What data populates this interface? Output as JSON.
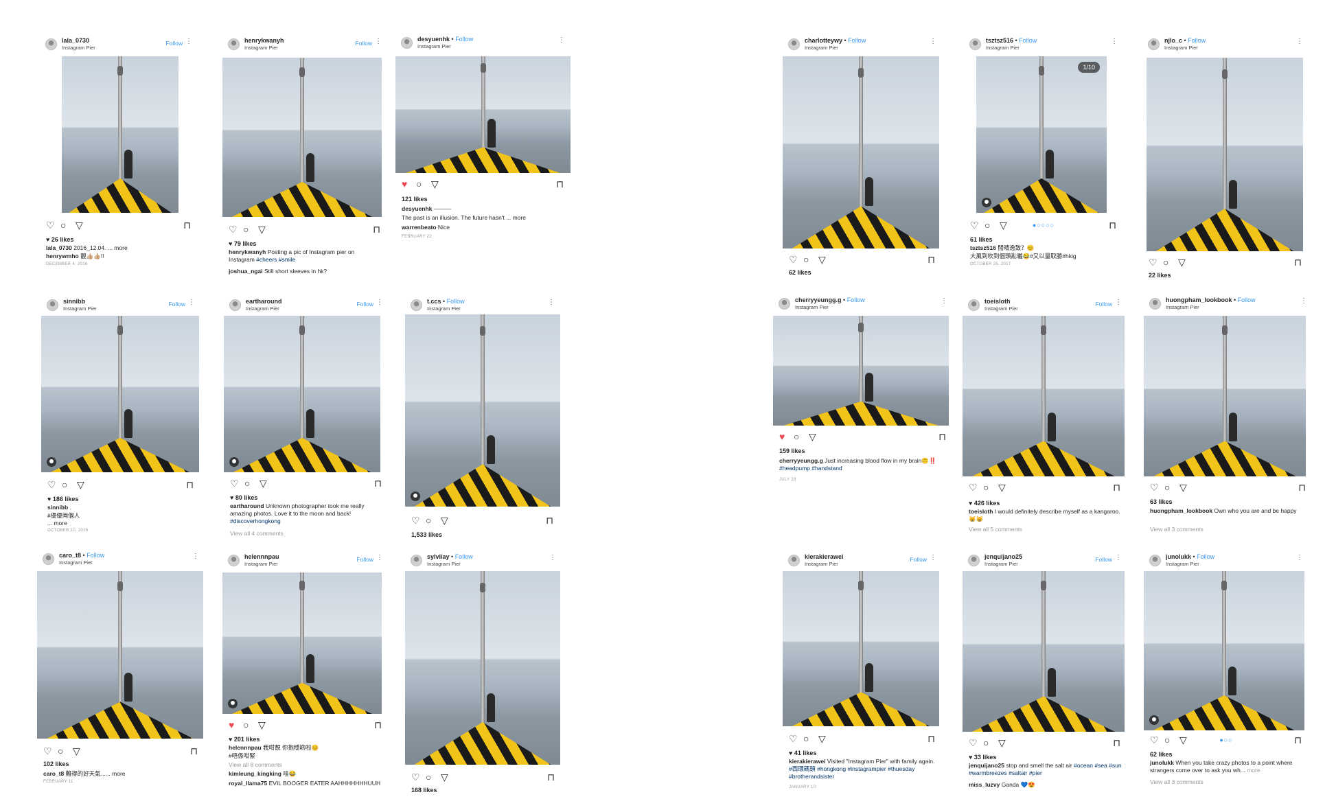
{
  "posts": [
    {
      "id": "p1",
      "user": "lala_0730",
      "location": "Instagram Pier",
      "follow": "Follow",
      "likes": "26 likes",
      "caption_user": "lala_0730",
      "caption": "2016_12.04.",
      "more": "... more",
      "comment_user": "henrywmho",
      "comment": "靚👍🏼👍🏼!!",
      "date": "DECEMBER 4, 2016"
    },
    {
      "id": "p2",
      "user": "henrykwanyh",
      "location": "Instagram Pier",
      "follow": "Follow",
      "likes": "79 likes",
      "caption_user": "henrykwanyh",
      "caption": "Posting a pic of Instagram pier on Instagram",
      "hashtags": "#cheers #smile",
      "comment_user": "joshua_ngai",
      "comment": "Still short sleeves in hk?"
    },
    {
      "id": "p3",
      "user": "desyuenhk",
      "dot": " • ",
      "follow": "Follow",
      "location": "Instagram Pier",
      "likes": "121 likes",
      "caption_user": "desyuenhk",
      "caption": "———",
      "line2": "The past is an illusion. The future hasn't",
      "more": "... more",
      "comment_user": "warrenbeato",
      "comment": "Nice",
      "date": "FEBRUARY 22"
    },
    {
      "id": "p4",
      "user": "sinnibb",
      "location": "Instagram Pier",
      "follow": "Follow",
      "likes": "186 likes",
      "caption_user": "sinnibb",
      "caption": ".",
      "hashtags": "#優優両個人",
      "more": "... more",
      "date": "OCTOBER 10, 2016"
    },
    {
      "id": "p5",
      "user": "eartharound",
      "location": "Instagram Pier",
      "follow": "Follow",
      "likes": "80 likes",
      "caption_user": "eartharound",
      "caption": "Unknown photographer took me really amazing photos. Love it to the moon and back!",
      "hashtags": "#discoverhongkong",
      "view": "View all 4 comments"
    },
    {
      "id": "p6",
      "user": "t.ccs",
      "dot": " • ",
      "follow": "Follow",
      "location": "Instagram Pier",
      "likes": "1,533 likes"
    },
    {
      "id": "p7",
      "user": "caro_t8",
      "dot": " • ",
      "follow": "Follow",
      "location": "Instagram Pier",
      "likes": "102 likes",
      "caption_user": "caro_t8",
      "caption": "難得的好天氣......",
      "more": "more",
      "date": "FEBRUARY 11"
    },
    {
      "id": "p8",
      "user": "helennnpau",
      "location": "Instagram Pier",
      "follow": "Follow",
      "likes": "201 likes",
      "caption_user": "helennnpau",
      "caption": "我咁靚 你抱穩啲啦😊",
      "hashtags": "#唔係咁緊",
      "view": "View all 8 comments",
      "comment_user": "kimleung_kingking",
      "comment": "哇😂",
      "comment2_user": "royal_llama75",
      "comment2": "EVIL BOOGER EATER AAHHHHHHHUUH"
    },
    {
      "id": "p9",
      "user": "sylviiay",
      "dot": " • ",
      "follow": "Follow",
      "location": "Instagram Pier",
      "likes": "168 likes"
    },
    {
      "id": "p10",
      "user": "charlotteywy",
      "dot": " • ",
      "follow": "Follow",
      "location": "Instagram Pier",
      "likes": "62 likes"
    },
    {
      "id": "p11",
      "user": "tsztsz516",
      "dot": " • ",
      "follow": "Follow",
      "location": "Instagram Pier",
      "badge": "1/10",
      "likes": "61 likes",
      "caption_user": "tsztsz516",
      "caption": "閒晴逸致？😊",
      "line2": "大風到吹到個頭亂曬😂#又以量取勝#hkig",
      "date": "OCTOBER 25, 2017"
    },
    {
      "id": "p12",
      "user": "njlo_c",
      "dot": " • ",
      "follow": "Follow",
      "location": "Instagram Pier",
      "likes": "22 likes"
    },
    {
      "id": "p13",
      "user": "cherryyeungg.g",
      "dot": " • ",
      "follow": "Follow",
      "location": "Instagram Pier",
      "likes": "159 likes",
      "caption_user": "cherryyeungg.g",
      "caption": "Just increasing blood flow in my brain🙃‼️",
      "hashtags": "#headpump #handstand",
      "date": "JULY 28"
    },
    {
      "id": "p14",
      "user": "toeisloth",
      "location": "Instagram Pier",
      "follow": "Follow",
      "likes": "426 likes",
      "caption_user": "toeisloth",
      "caption": "I would definitely describe myself as a kangaroo. 😸😸",
      "view": "View all 5 comments"
    },
    {
      "id": "p15",
      "user": "huongpham_lookbook",
      "dot": " • ",
      "follow": "Follow",
      "location": "Instagram Pier",
      "likes": "63 likes",
      "caption_user": "huongpham_lookbook",
      "caption": "Own who you are and be happy",
      "view": "View all 3 comments"
    },
    {
      "id": "p16",
      "user": "kierakierawei",
      "location": "Instagram Pier",
      "follow": "Follow",
      "likes": "41 likes",
      "caption_user": "kierakierawei",
      "caption": "Visited \"Instagram Pier\" with family again.",
      "hashtags": "#西環碼頭 #hongkong #instagrampier #thuesday #brotherandsister",
      "date": "JANUARY 10"
    },
    {
      "id": "p17",
      "user": "jenquijano25",
      "location": "Instagram Pier",
      "follow": "Follow",
      "likes": "33 likes",
      "caption_user": "jenquijano25",
      "caption": "stop and smell the salt air",
      "hashtags": "#ocean #sea #sun #warmbreezes #saltair #pier",
      "comment_user": "miss_luzvy",
      "comment": "Ganda 💙😍"
    },
    {
      "id": "p18",
      "user": "junolukk",
      "dot": " • ",
      "follow": "Follow",
      "location": "Instagram Pier",
      "likes": "62 likes",
      "caption_user": "junolukk",
      "caption": "When you take crazy photos to a point where strangers come over to ask you wh...",
      "more": "more",
      "view": "View all 3 comments"
    }
  ]
}
